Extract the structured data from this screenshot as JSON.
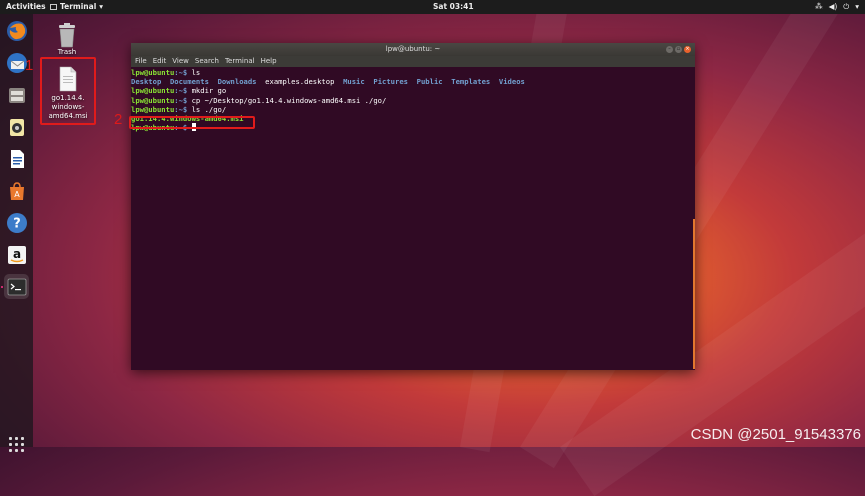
{
  "topbar": {
    "activities": "Activities",
    "app_name": "Terminal",
    "clock": "Sat 03:41"
  },
  "desktop": {
    "trash_label": "Trash",
    "file_label_l1": "go1.14.4.",
    "file_label_l2": "windows-",
    "file_label_l3": "amd64.msi",
    "annotation_1": "1",
    "annotation_2": "2"
  },
  "dock": {
    "items": [
      "firefox-icon",
      "thunderbird-icon",
      "files-icon",
      "rhythmbox-icon",
      "writer-icon",
      "software-icon",
      "help-icon",
      "amazon-icon",
      "terminal-icon"
    ]
  },
  "terminal": {
    "title": "lpw@ubuntu: ~",
    "menu": [
      "File",
      "Edit",
      "View",
      "Search",
      "Terminal",
      "Help"
    ],
    "prompt_user": "lpw@ubuntu",
    "prompt_path": ":~$",
    "cmd1": " ls",
    "ls_out": {
      "desktop": "Desktop",
      "documents": "Documents",
      "downloads": "Downloads",
      "examples": "examples.desktop",
      "music": "Music",
      "pictures": "Pictures",
      "public": "Public",
      "templates": "Templates",
      "videos": "Videos"
    },
    "cmd2": " mkdir go",
    "cmd3": " cp ~/Desktop/go1.14.4.windows-amd64.msi ./go/",
    "cmd4": " ls ./go/",
    "out4": "go1.14.4.windows-amd64.msi",
    "cmd5": " "
  },
  "watermark": "CSDN @2501_91543376",
  "colors": {
    "terminal_bg": "#300a24",
    "prompt_user": "#8ae234",
    "prompt_path": "#729fcf",
    "annotation": "#e01b1b"
  }
}
